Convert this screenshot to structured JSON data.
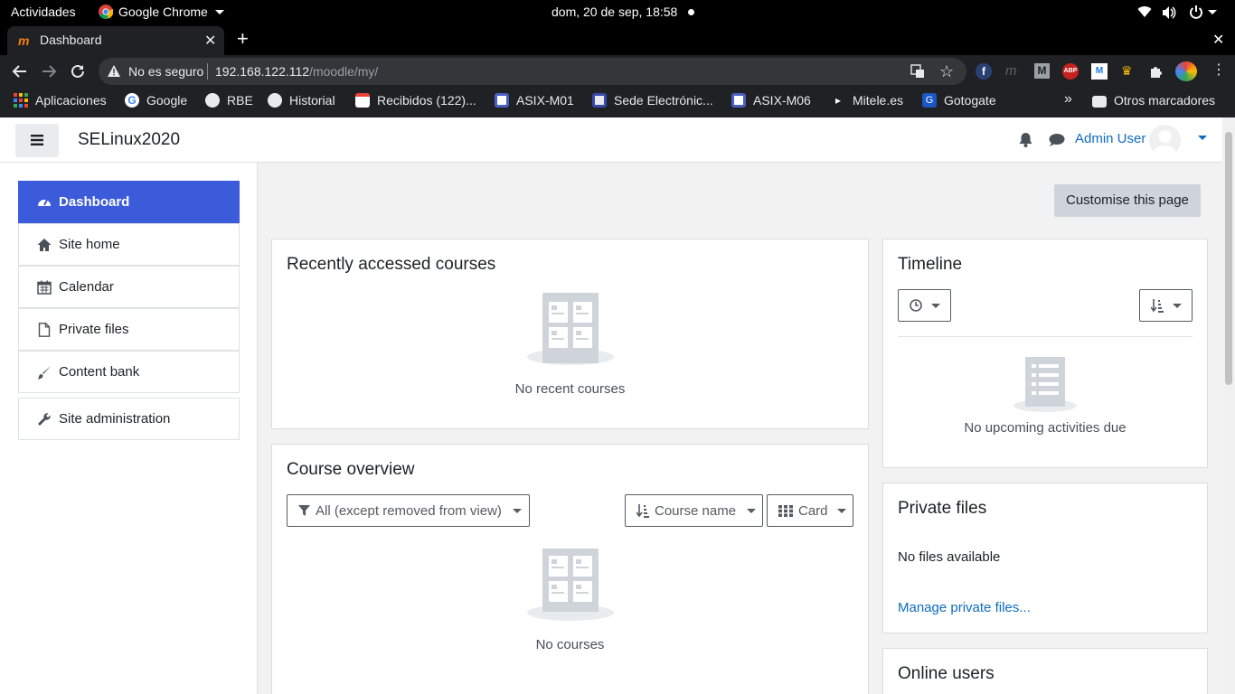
{
  "system": {
    "activities": "Actividades",
    "app_name": "Google Chrome",
    "datetime": "dom, 20 de sep, 18:58"
  },
  "browser": {
    "tab_title": "Dashboard",
    "security_label": "No es seguro",
    "url_host": "192.168.122.112",
    "url_path": "/moodle/my/",
    "bookmarks": [
      {
        "label": "Aplicaciones",
        "icon": "apps-grid-icon"
      },
      {
        "label": "Google",
        "icon": "google-icon"
      },
      {
        "label": "RBE",
        "icon": "globe-icon"
      },
      {
        "label": "Historial",
        "icon": "globe-icon"
      },
      {
        "label": "Recibidos (122)...",
        "icon": "gmail-icon"
      },
      {
        "label": "ASIX-M01",
        "icon": "page-icon"
      },
      {
        "label": "Sede Electrónic...",
        "icon": "sede-icon"
      },
      {
        "label": "ASIX-M06",
        "icon": "page-icon"
      },
      {
        "label": "Mitele.es",
        "icon": "mitele-icon"
      },
      {
        "label": "Gotogate",
        "icon": "gotogate-icon"
      }
    ],
    "more_bookmarks": "»",
    "other_bookmarks": "Otros marcadores"
  },
  "moodle": {
    "site_name": "SELinux2020",
    "user_name": "Admin User",
    "nav": [
      {
        "label": "Dashboard",
        "icon": "dashboard-icon"
      },
      {
        "label": "Site home",
        "icon": "home-icon"
      },
      {
        "label": "Calendar",
        "icon": "calendar-icon"
      },
      {
        "label": "Private files",
        "icon": "file-icon"
      },
      {
        "label": "Content bank",
        "icon": "brush-icon"
      },
      {
        "label": "Site administration",
        "icon": "wrench-icon"
      }
    ],
    "customise_button": "Customise this page",
    "recent": {
      "title": "Recently accessed courses",
      "empty": "No recent courses"
    },
    "overview": {
      "title": "Course overview",
      "filter": "All (except removed from view)",
      "sort": "Course name",
      "view": "Card",
      "empty": "No courses"
    },
    "timeline": {
      "title": "Timeline",
      "empty": "No upcoming activities due"
    },
    "private_files": {
      "title": "Private files",
      "empty": "No files available",
      "manage_link": "Manage private files..."
    },
    "online_users": {
      "title": "Online users"
    }
  },
  "colors": {
    "accent": "#3b5bdb",
    "link": "#0f6cbf",
    "page_bg": "#f2f2f2"
  }
}
